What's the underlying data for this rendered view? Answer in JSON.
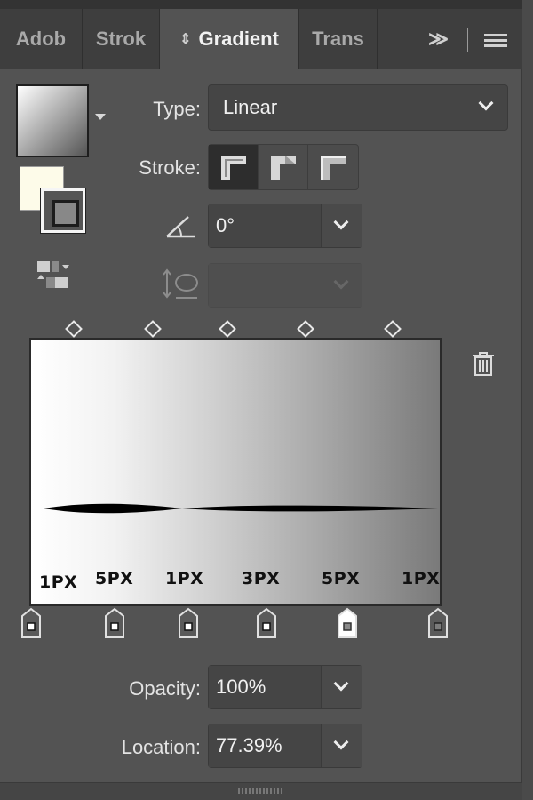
{
  "tabs": [
    {
      "label": "Adob"
    },
    {
      "label": "Strok"
    },
    {
      "label": "Gradient"
    },
    {
      "label": "Trans"
    }
  ],
  "tab_more": "≫",
  "type": {
    "label": "Type:",
    "value": "Linear"
  },
  "stroke": {
    "label": "Stroke:"
  },
  "angle": {
    "value": "0°"
  },
  "aspect": {
    "value": ""
  },
  "gradient_labels": [
    "1PX",
    "5PX",
    "1PX",
    "3PX",
    "5PX",
    "1PX"
  ],
  "opacity": {
    "label": "Opacity:",
    "value": "100%"
  },
  "location": {
    "label": "Location:",
    "value": "77.39%"
  },
  "icons": {
    "swatch_menu": "chevron-down-icon",
    "swap": "reverse-gradient-icon",
    "angle": "angle-icon",
    "aspect": "aspect-ratio-icon",
    "trash": "trash-icon"
  }
}
